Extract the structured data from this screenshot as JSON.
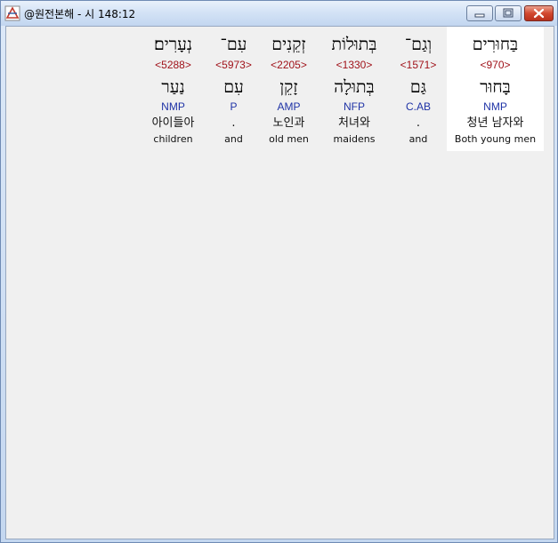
{
  "window": {
    "title": "@원전본해 - 시 148:12"
  },
  "words": [
    {
      "hebrew": "בַּחוּרִים",
      "strong": "<970>",
      "lemma": "בָּחוּר",
      "morph": "NMP",
      "korean": "청년 남자와",
      "english": "Both young men",
      "selected": true
    },
    {
      "hebrew": "וְגַם־",
      "strong": "<1571>",
      "lemma": "גַּם",
      "morph": "C.AB",
      "korean": ".",
      "english": "and",
      "selected": false
    },
    {
      "hebrew": "בְּתוּלוֹת",
      "strong": "<1330>",
      "lemma": "בְּתוּלָה",
      "morph": "NFP",
      "korean": "처녀와",
      "english": "maidens",
      "selected": false
    },
    {
      "hebrew": "זְקֵנִים",
      "strong": "<2205>",
      "lemma": "זָקֵן",
      "morph": "AMP",
      "korean": "노인과",
      "english": "old men",
      "selected": false
    },
    {
      "hebrew": "עִם־",
      "strong": "<5973>",
      "lemma": "עִם",
      "morph": "P",
      "korean": ".",
      "english": "and",
      "selected": false
    },
    {
      "hebrew": "נְעָרִים׃",
      "strong": "<5288>",
      "lemma": "נַעַר",
      "morph": "NMP",
      "korean": "아이들아",
      "english": "children",
      "selected": false
    }
  ],
  "colors": {
    "strong": "#a0121a",
    "morph": "#1f33a6",
    "selected_bg": "#ffffff",
    "panel_bg": "#f0f0f0"
  }
}
